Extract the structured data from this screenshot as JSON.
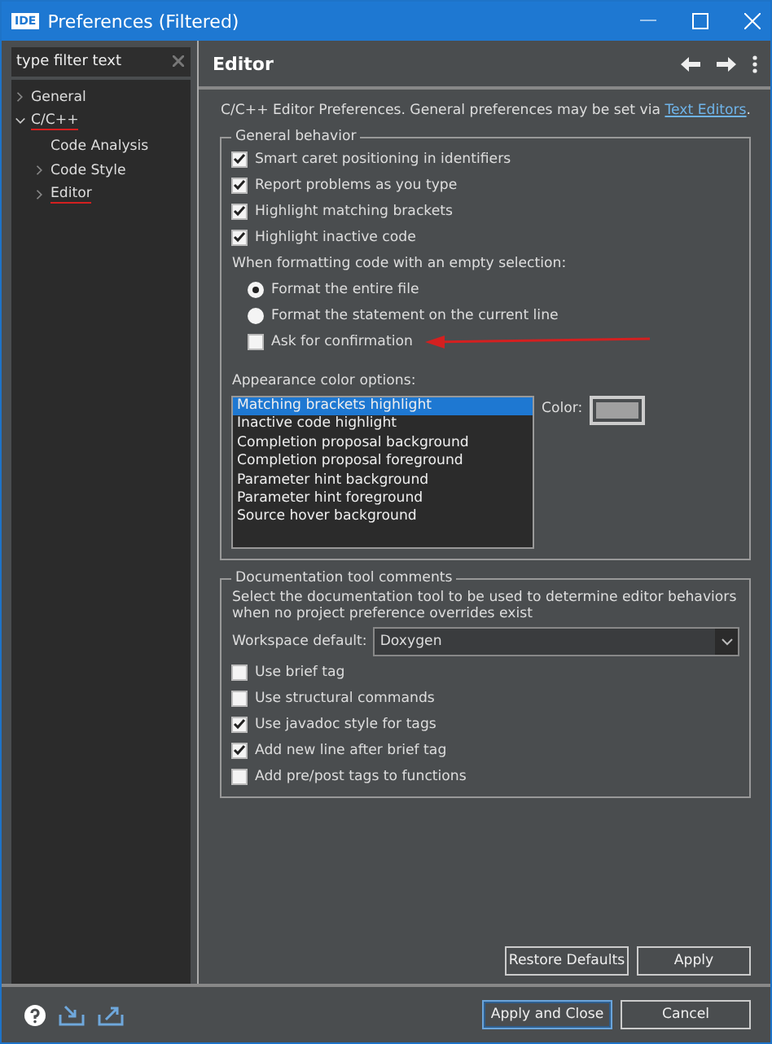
{
  "window": {
    "title": "Preferences (Filtered)",
    "app_badge": "IDE"
  },
  "filter": {
    "placeholder": "type filter text"
  },
  "tree": [
    {
      "label": "General",
      "expanded": false,
      "marked": false
    },
    {
      "label": "C/C++",
      "expanded": true,
      "marked": true,
      "children": [
        {
          "label": "Code Analysis",
          "expandable": false,
          "marked": false
        },
        {
          "label": "Code Style",
          "expandable": true,
          "marked": false
        },
        {
          "label": "Editor",
          "expandable": true,
          "marked": true
        }
      ]
    }
  ],
  "page": {
    "title": "Editor",
    "intro": "C/C++ Editor Preferences. General preferences may be set via ",
    "intro_link": "Text Editors",
    "intro_end": "."
  },
  "general": {
    "title": "General behavior",
    "options": [
      {
        "kind": "check",
        "label": "Smart caret positioning in identifiers",
        "checked": true
      },
      {
        "kind": "check",
        "label": "Report problems as you type",
        "checked": true
      },
      {
        "kind": "check",
        "label": "Highlight matching brackets",
        "checked": true
      },
      {
        "kind": "check",
        "label": "Highlight inactive code",
        "checked": true
      },
      {
        "kind": "text",
        "label": "When formatting code with an empty selection:"
      },
      {
        "kind": "radio",
        "label": "Format the entire file",
        "checked": true
      },
      {
        "kind": "radio",
        "label": "Format the statement on the current line",
        "checked": false
      },
      {
        "kind": "subcheck",
        "label": "Ask for confirmation",
        "checked": false,
        "arrow": true
      }
    ]
  },
  "appearance": {
    "title": "Appearance color options:",
    "items": [
      {
        "label": "Matching brackets highlight",
        "selected": true
      },
      {
        "label": "Inactive code highlight",
        "selected": false
      },
      {
        "label": "Completion proposal background",
        "selected": false
      },
      {
        "label": "Completion proposal foreground",
        "selected": false
      },
      {
        "label": "Parameter hint background",
        "selected": false
      },
      {
        "label": "Parameter hint foreground",
        "selected": false
      },
      {
        "label": "Source hover background",
        "selected": false
      }
    ],
    "color_label": "Color:",
    "color": "#a0a0a0"
  },
  "docs": {
    "title": "Documentation tool comments",
    "description": "Select the documentation tool to be used to determine editor behaviors when no project preference overrides exist",
    "workspace_label": "Workspace default:",
    "workspace_value": "Doxygen",
    "options": [
      {
        "label": "Use brief tag",
        "checked": false
      },
      {
        "label": "Use structural commands",
        "checked": false
      },
      {
        "label": "Use javadoc style for tags",
        "checked": true
      },
      {
        "label": "Add new line after brief tag",
        "checked": true
      },
      {
        "label": "Add pre/post tags to functions",
        "checked": false
      }
    ]
  },
  "page_buttons": [
    "Restore Defaults",
    "Apply"
  ],
  "dialog_buttons": [
    {
      "label": "Apply and Close",
      "default": true
    },
    {
      "label": "Cancel",
      "default": false
    }
  ]
}
